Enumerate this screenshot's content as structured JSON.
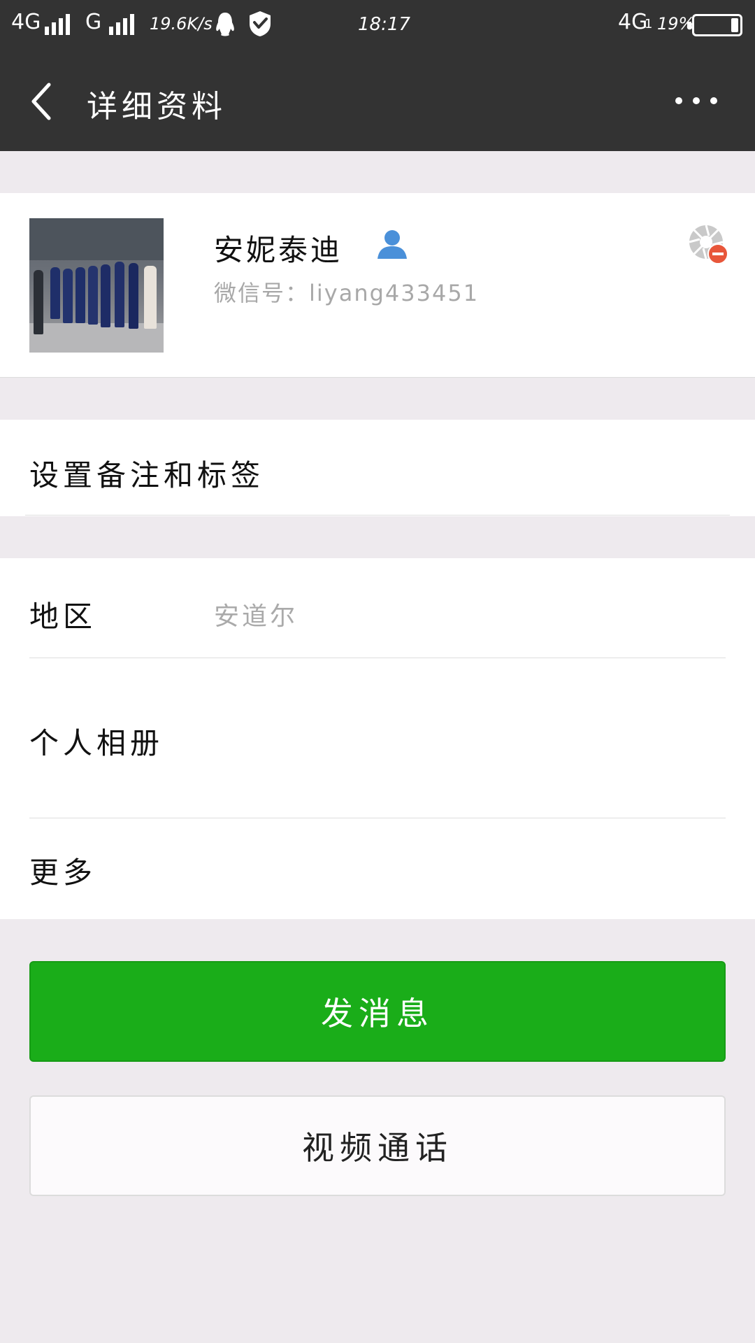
{
  "status_bar": {
    "network_left": "4G",
    "network_second": "G",
    "speed": "19.6K/s",
    "time": "18:17",
    "network_right": "4G",
    "sim_index": "1",
    "battery": "19%"
  },
  "header": {
    "title": "详细资料",
    "back_icon": "chevron-left",
    "more_icon": "more-dots"
  },
  "profile": {
    "name": "安妮泰迪",
    "wechat_id": "微信号：liyang433451",
    "contact_icon": "person-icon",
    "status_icon": "blocked-moments-icon"
  },
  "rows": {
    "remark": "设置备注和标签",
    "region_label": "地区",
    "region_value": "安道尔",
    "album": "个人相册",
    "more": "更多"
  },
  "buttons": {
    "send_message": "发消息",
    "video_call": "视频通话"
  },
  "colors": {
    "header_bg": "#333333",
    "send_button": "#1aad19",
    "page_bg": "#eeeaee"
  }
}
